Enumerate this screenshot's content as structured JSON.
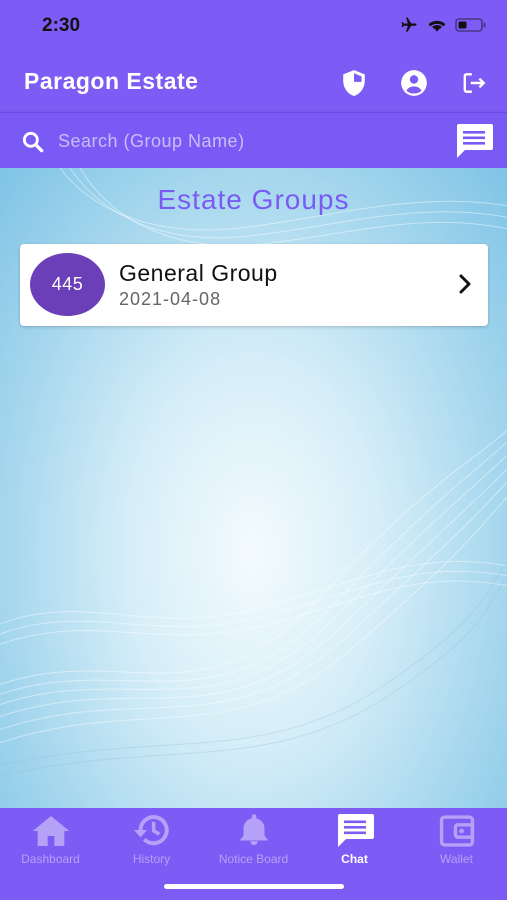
{
  "status_bar": {
    "time": "2:30",
    "icons": [
      "airplane-icon",
      "wifi-icon",
      "battery-icon"
    ]
  },
  "app_bar": {
    "title": "Paragon Estate",
    "actions": [
      "shield-icon",
      "account-icon",
      "logout-icon"
    ]
  },
  "search": {
    "placeholder": "Search (Group Name)",
    "value": ""
  },
  "main": {
    "heading": "Estate Groups",
    "groups": [
      {
        "badge": "445",
        "name": "General Group",
        "date": "2021-04-08"
      }
    ]
  },
  "tabs": [
    {
      "label": "Dashboard",
      "icon": "home-icon",
      "active": false
    },
    {
      "label": "History",
      "icon": "history-icon",
      "active": false
    },
    {
      "label": "Notice Board",
      "icon": "bell-icon",
      "active": false
    },
    {
      "label": "Chat",
      "icon": "chat-icon",
      "active": true
    },
    {
      "label": "Wallet",
      "icon": "wallet-icon",
      "active": false
    }
  ],
  "colors": {
    "primary": "#7c5cf4",
    "badge": "#6a3fb8",
    "heading": "#7a5af5",
    "tab_inactive": "#b3a2f7",
    "tab_active": "#ffffff"
  }
}
